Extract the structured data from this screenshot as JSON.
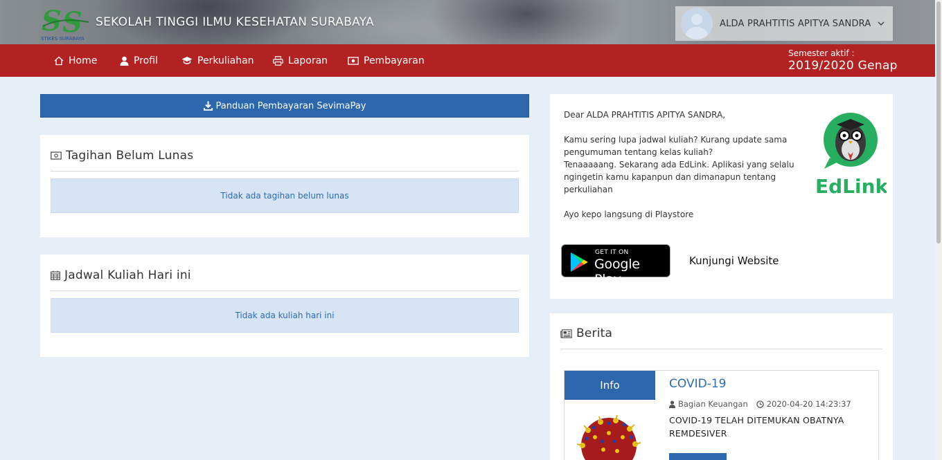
{
  "header": {
    "logo_text": "STIKES SURABAYA",
    "institution": "SEKOLAH TINGGI ILMU KESEHATAN SURABAYA",
    "user_name": "ALDA PRAHTITIS APITYA SANDRA"
  },
  "nav": {
    "items": [
      {
        "label": "Home",
        "icon": "home-icon"
      },
      {
        "label": "Profil",
        "icon": "user-icon"
      },
      {
        "label": "Perkuliahan",
        "icon": "graduation-cap-icon"
      },
      {
        "label": "Laporan",
        "icon": "print-icon"
      },
      {
        "label": "Pembayaran",
        "icon": "money-icon"
      }
    ],
    "semester_label": "Semester aktif :",
    "semester_value": "2019/2020 Genap"
  },
  "left": {
    "guide_button": "Panduan Pembayaran SevimaPay",
    "tagihan": {
      "title": "Tagihan Belum Lunas",
      "empty_text": "Tidak ada tagihan belum lunas"
    },
    "jadwal": {
      "title": "Jadwal Kuliah Hari ini",
      "empty_text": "Tidak ada kuliah hari ini"
    }
  },
  "edlink": {
    "greeting": "Dear ALDA PRAHTITIS APITYA SANDRA,",
    "line1": "Kamu sering lupa jadwal kuliah? Kurang update sama pengumuman tentang kelas kuliah?",
    "line2": "Tenaaaaang. Sekarang ada EdLink. Aplikasi yang selalu ngingetin kamu kapanpun dan dimanapun tentang perkuliahan",
    "line3": "Ayo kepo langsung di Playstore",
    "brand": "EdLink",
    "gplay_small": "GET IT ON",
    "gplay_big": "Google Play",
    "visit_link": "Kunjungi Website"
  },
  "berita": {
    "title": "Berita",
    "news": [
      {
        "badge": "Info",
        "title": "COVID-19",
        "author": "Bagian Keuangan",
        "datetime": "2020-04-20 14:23:37",
        "summary": "COVID-19 TELAH DITEMUKAN OBATNYA REMDESIVER"
      }
    ]
  },
  "colors": {
    "navbar": "#b22222",
    "primary": "#2c66ad",
    "alert_bg": "#d6e4f6",
    "page_bg": "#e6eef7",
    "edlink_green": "#27ae60"
  }
}
